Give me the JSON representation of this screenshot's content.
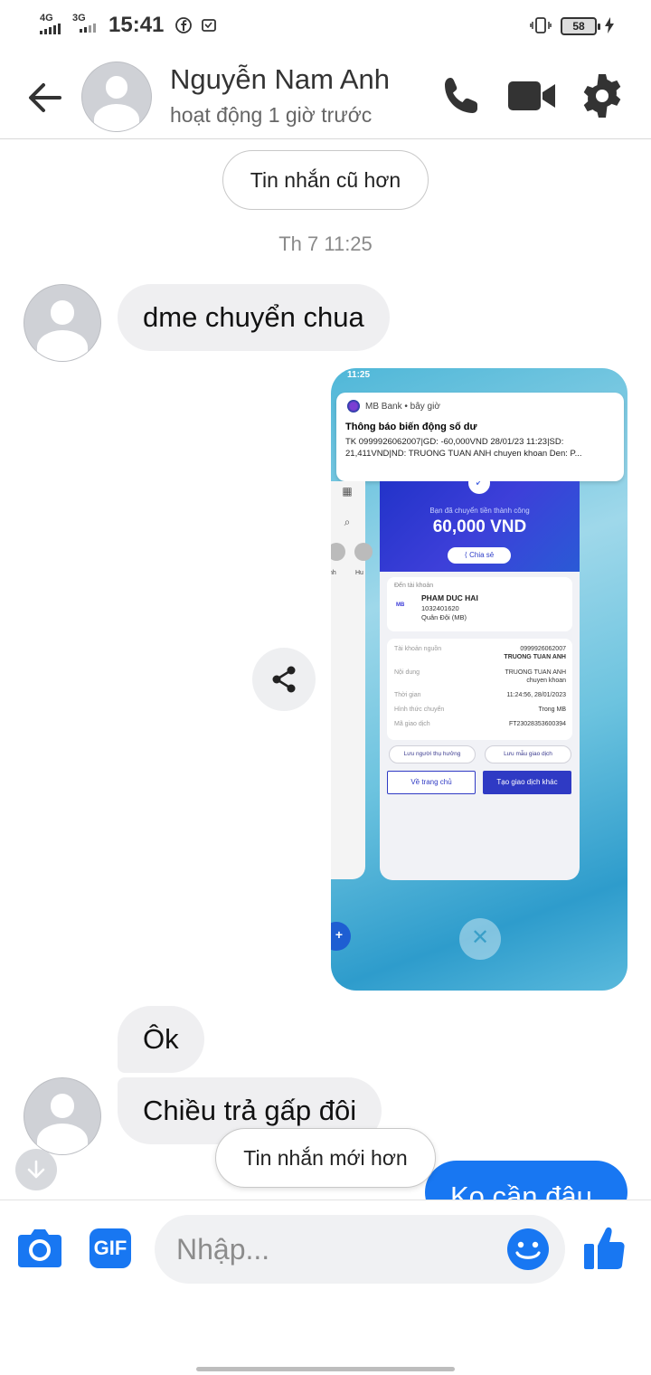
{
  "status_bar": {
    "net1": "4G",
    "net2": "3G",
    "time": "15:41",
    "battery": "58"
  },
  "header": {
    "name": "Nguyễn Nam Anh",
    "status": "hoạt động 1 giờ trước"
  },
  "chat": {
    "older_button": "Tin nhắn cũ hơn",
    "timestamp": "Th 7 11:25",
    "newer_button": "Tin nhắn mới hơn",
    "messages": [
      {
        "from": "them",
        "text": "dme chuyển chua"
      },
      {
        "from": "them",
        "text": "Ôk"
      },
      {
        "from": "them",
        "text": "Chiều trả gấp đôi"
      },
      {
        "from": "me",
        "text": "Ko cần đâu"
      }
    ]
  },
  "attachment": {
    "status_time": "11:25",
    "notification": {
      "app": "MB Bank • bây giờ",
      "title": "Thông báo biến động số dư",
      "line1": "TK 0999926062007|GD: -60,000VND 28/01/23 11:23|SD:",
      "line2": "21,411VND|ND: TRUONG TUAN ANH chuyen khoan Den: P..."
    },
    "success_text": "Bạn đã chuyển tiền thành công",
    "amount": "60,000 VND",
    "share_label": "Chia sẻ",
    "recipient": {
      "label": "Đến tài khoản",
      "bank_logo": "MB",
      "name": "PHAM DUC HAI",
      "account": "1032401620",
      "bank": "Quân Đội (MB)"
    },
    "details": [
      {
        "label": "Tài khoản nguồn",
        "value": "0999926062007",
        "value2": "TRUONG TUAN ANH"
      },
      {
        "label": "Nội dung",
        "value": "TRUONG TUAN ANH",
        "value2": "chuyen khoan"
      },
      {
        "label": "Thời gian",
        "value": "11:24:56, 28/01/2023"
      },
      {
        "label": "Hình thức chuyển",
        "value": "Trong MB"
      },
      {
        "label": "Mã giao dịch",
        "value": "FT23028353600394"
      }
    ],
    "save_beneficiary": "Lưu người thụ hưởng",
    "save_template": "Lưu mẫu giao dịch",
    "home_button": "Về trang chủ",
    "new_tx_button": "Tạo giao dịch khác",
    "side_labels": [
      "nh",
      "Hu"
    ]
  },
  "composer": {
    "placeholder": "Nhập...",
    "gif_label": "GIF"
  },
  "colors": {
    "brand": "#1877f2",
    "bubble_in": "#efeff1",
    "mb_blue": "#2f3ac4"
  },
  "icons": [
    "back-arrow-icon",
    "phone-icon",
    "video-icon",
    "gear-icon",
    "share-icon",
    "arrow-down-icon",
    "camera-icon",
    "gif-icon",
    "emoji-icon",
    "thumbs-up-icon"
  ]
}
